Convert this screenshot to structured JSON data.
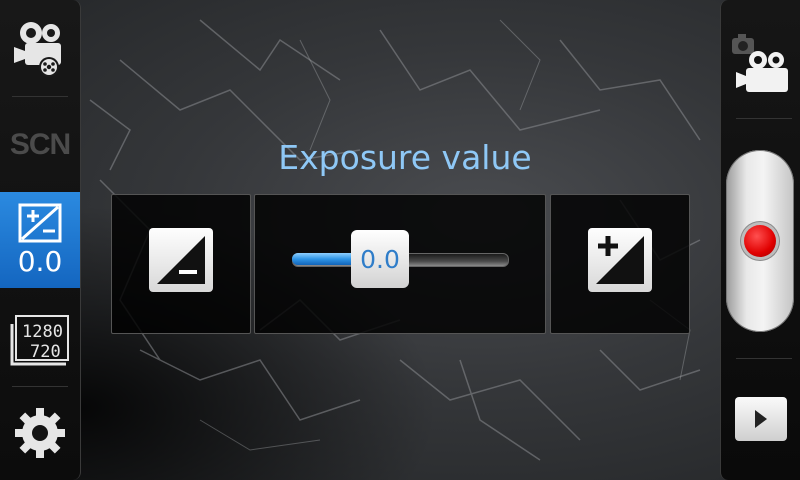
{
  "left_rail": {
    "items": [
      {
        "id": "camera-mode",
        "icon": "video-camera-icon"
      },
      {
        "id": "scene-mode",
        "label": "SCN"
      },
      {
        "id": "exposure",
        "icon": "exposure-plus-minus-icon",
        "value": "0.0",
        "active": true
      },
      {
        "id": "resolution",
        "icon": "resolution-icon",
        "line1": "1280",
        "line2": "720"
      },
      {
        "id": "settings",
        "icon": "gear-icon"
      }
    ]
  },
  "right_rail": {
    "mode_switch_icon": "camera-video-switch-icon",
    "record_icon": "record-icon",
    "play_icon": "play-icon"
  },
  "exposure_panel": {
    "title": "Exposure value",
    "value_label": "0.0",
    "decrease_icon": "exposure-minus-icon",
    "increase_icon": "exposure-plus-icon",
    "slider_fraction": 0.41
  },
  "colors": {
    "accent": "#1f7fd8",
    "title": "#8fc8f6",
    "record": "#e00000"
  }
}
